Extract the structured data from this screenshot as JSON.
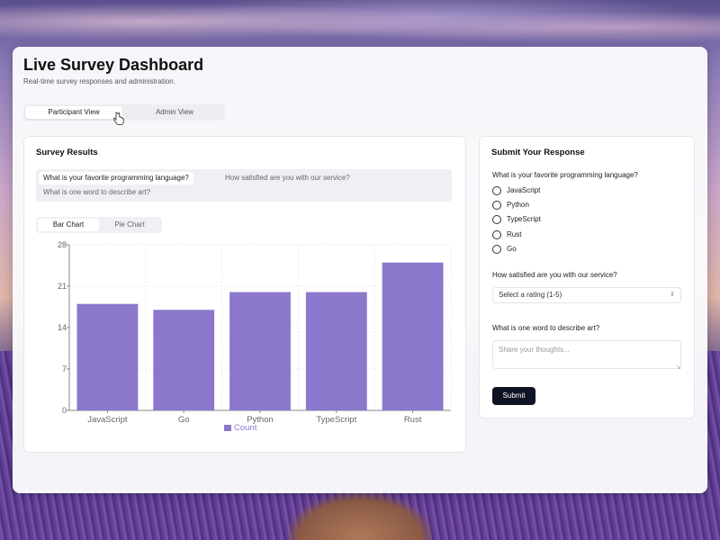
{
  "app": {
    "title": "Live Survey Dashboard",
    "subtitle": "Real-time survey responses and administration."
  },
  "view_tabs": [
    {
      "label": "Participant View",
      "active": true
    },
    {
      "label": "Admin View",
      "active": false
    }
  ],
  "results": {
    "title": "Survey Results",
    "question_tabs": [
      {
        "label": "What is your favorite programming language?",
        "active": true
      },
      {
        "label": "How satisfied are you with our service?",
        "active": false
      },
      {
        "label": "What is one word to describe art?",
        "active": false
      }
    ],
    "chart_tabs": [
      {
        "label": "Bar Chart",
        "active": true
      },
      {
        "label": "Pie Chart",
        "active": false
      }
    ]
  },
  "chart_data": {
    "type": "bar",
    "categories": [
      "JavaScript",
      "Go",
      "Python",
      "TypeScript",
      "Rust"
    ],
    "series": [
      {
        "name": "Count",
        "values": [
          18,
          17,
          20,
          20,
          25
        ],
        "color": "#8b78cc"
      }
    ],
    "yticks": [
      "0",
      "7",
      "14",
      "21",
      "28"
    ],
    "ylim": [
      0,
      28
    ],
    "grid": true,
    "legend": "bottom"
  },
  "response": {
    "title": "Submit Your Response",
    "q1": {
      "label": "What is your favorite programming language?",
      "options": [
        "JavaScript",
        "Python",
        "TypeScript",
        "Rust",
        "Go"
      ]
    },
    "q2": {
      "label": "How satisfied are you with our service?",
      "select_value": "Select a rating (1-5)"
    },
    "q3": {
      "label": "What is one word to describe art?",
      "placeholder": "Share your thoughts..."
    },
    "submit_label": "Submit"
  }
}
